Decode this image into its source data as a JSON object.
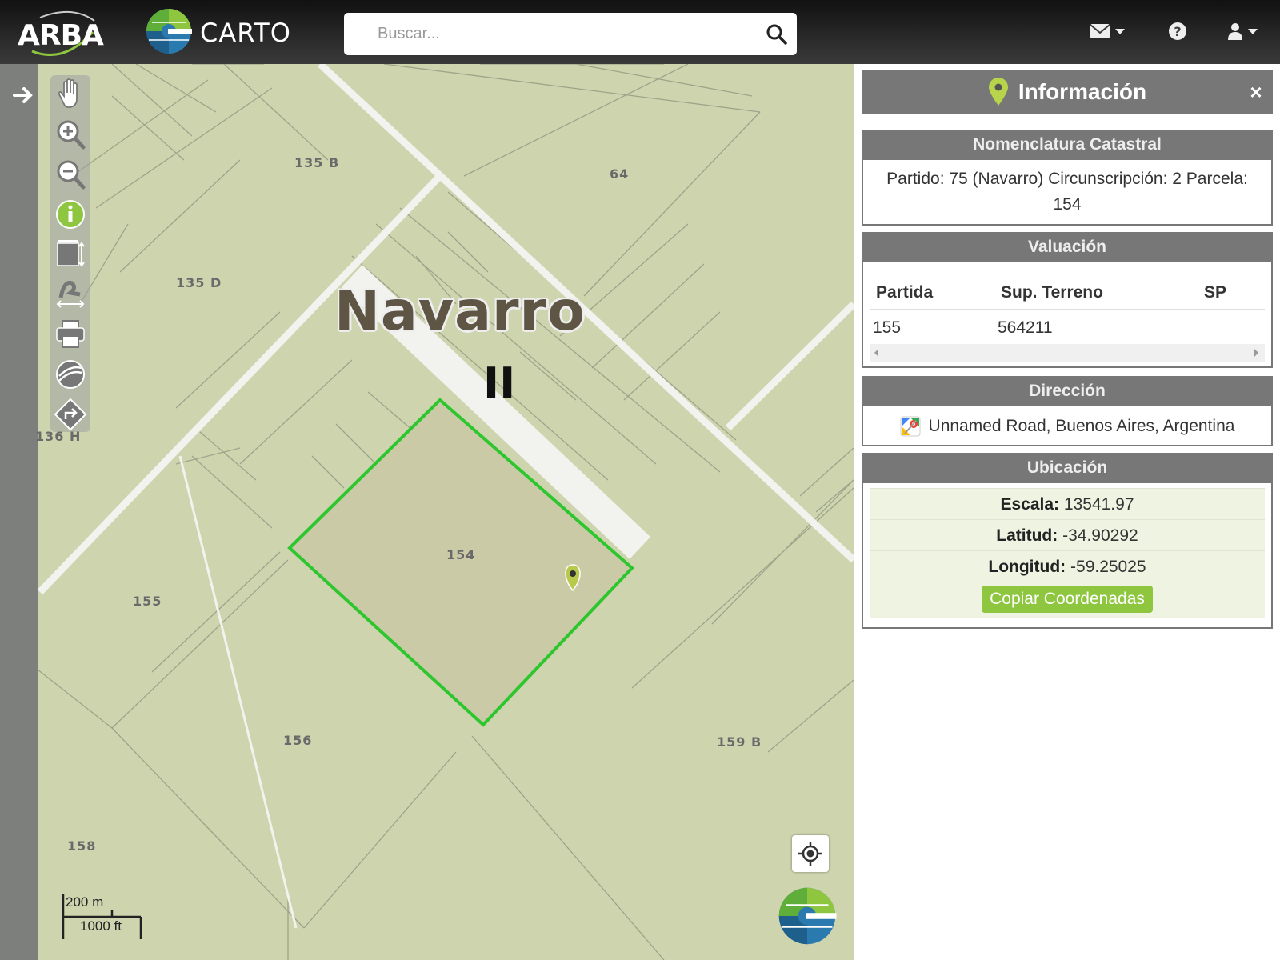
{
  "navbar": {
    "brand_left": "ARBA",
    "brand_right": "CARTO",
    "search": {
      "placeholder": "Buscar...",
      "value": ""
    },
    "icons": [
      "search-icon",
      "mail-icon",
      "help-icon",
      "user-icon"
    ]
  },
  "map": {
    "town_name": "Navarro",
    "roman_numeral": "II",
    "parcels": [
      "135 B",
      "64",
      "135 D",
      "136 H",
      "154",
      "155",
      "156",
      "159 B",
      "158"
    ],
    "scale": {
      "metric": "200 m",
      "imperial": "1000 ft"
    },
    "selected_parcel_color": "#2ec62e",
    "selected_parcel_fill": "#cbcaa6",
    "background_color": "#cdd4ae",
    "toolbar": [
      "pan-hand-icon",
      "zoom-in-icon",
      "zoom-out-icon",
      "info-icon",
      "select-area-icon",
      "measure-icon",
      "print-icon",
      "layers-icon",
      "route-icon"
    ]
  },
  "panel": {
    "title": "Información",
    "close": "×",
    "nomenclatura": {
      "heading": "Nomenclatura Catastral",
      "text": "Partido: 75 (Navarro) Circunscripción: 2 Parcela: 154"
    },
    "valuacion": {
      "heading": "Valuación",
      "columns": [
        "Partida",
        "Sup. Terreno",
        "SP"
      ],
      "rows": [
        {
          "partida": "155",
          "sup_terreno": "564211",
          "sp": ""
        }
      ]
    },
    "direccion": {
      "heading": "Dirección",
      "text": "Unnamed Road, Buenos Aires, Argentina"
    },
    "ubicacion": {
      "heading": "Ubicación",
      "escala_label": "Escala:",
      "escala": "13541.97",
      "latitud_label": "Latitud:",
      "latitud": "-34.90292",
      "longitud_label": "Longitud:",
      "longitud": "-59.25025",
      "copy_button": "Copiar Coordenadas"
    }
  },
  "colors": {
    "panel_header": "#777777",
    "copy_button": "#8ec63f",
    "ubicacion_row": "#eef3e2"
  }
}
